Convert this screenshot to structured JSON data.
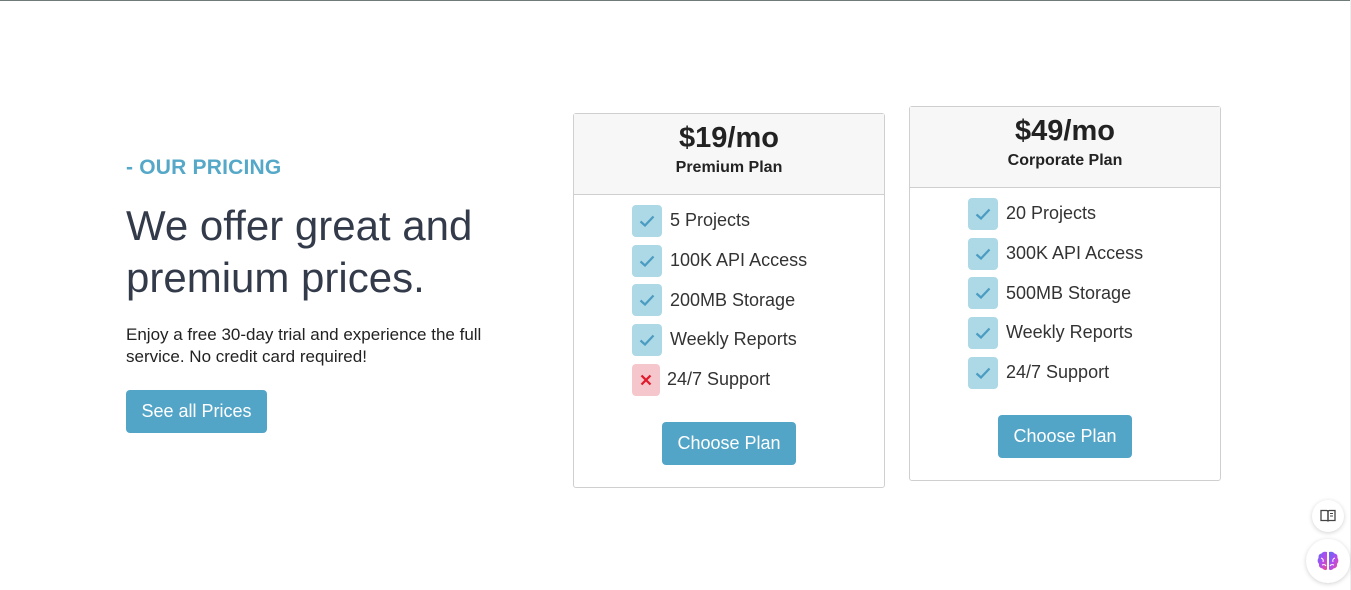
{
  "hero": {
    "eyebrow": "- OUR PRICING",
    "headline": "We offer great and premium prices.",
    "description": "Enjoy a free 30-day trial and experience the full service. No credit card required!",
    "cta_label": "See all Prices"
  },
  "plans": [
    {
      "price": "$19/mo",
      "name": "Premium Plan",
      "features": [
        {
          "label": "5 Projects",
          "included": true
        },
        {
          "label": "100K API Access",
          "included": true
        },
        {
          "label": "200MB Storage",
          "included": true
        },
        {
          "label": "Weekly Reports",
          "included": true
        },
        {
          "label": "24/7 Support",
          "included": false
        }
      ],
      "button_label": "Choose Plan"
    },
    {
      "price": "$49/mo",
      "name": "Corporate Plan",
      "features": [
        {
          "label": "20 Projects",
          "included": true
        },
        {
          "label": "300K API Access",
          "included": true
        },
        {
          "label": "500MB Storage",
          "included": true
        },
        {
          "label": "Weekly Reports",
          "included": true
        },
        {
          "label": "24/7 Support",
          "included": true
        }
      ],
      "button_label": "Choose Plan"
    }
  ],
  "floating_buttons": [
    {
      "icon": "book-icon"
    },
    {
      "icon": "brain-icon"
    }
  ],
  "colors": {
    "accent": "#53a5c8",
    "check_bg": "#add8e6",
    "cross_bg": "#f5c6cb",
    "cross": "#e0192b"
  }
}
